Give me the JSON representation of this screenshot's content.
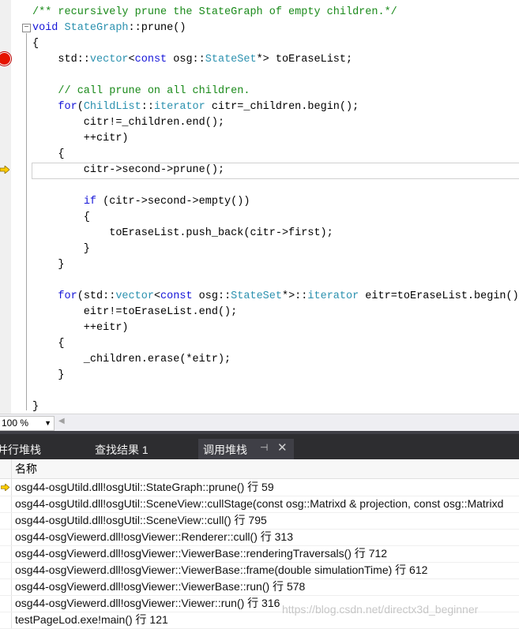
{
  "editor": {
    "lines": [
      [
        [
          "cm",
          "/** recursively prune the StateGraph of empty children.*/"
        ]
      ],
      [
        [
          "kw",
          "void"
        ],
        [
          "tx",
          " "
        ],
        [
          "ty",
          "StateGraph"
        ],
        [
          "tx",
          "::prune()"
        ]
      ],
      [
        [
          "tx",
          "{"
        ]
      ],
      [
        [
          "tx",
          "    std::"
        ],
        [
          "ty",
          "vector"
        ],
        [
          "tx",
          "<"
        ],
        [
          "kw",
          "const"
        ],
        [
          "tx",
          " osg::"
        ],
        [
          "ty",
          "StateSet"
        ],
        [
          "tx",
          "*> toEraseList;"
        ]
      ],
      [],
      [
        [
          "tx",
          "    "
        ],
        [
          "cm",
          "// call prune on all children."
        ]
      ],
      [
        [
          "tx",
          "    "
        ],
        [
          "kw",
          "for"
        ],
        [
          "tx",
          "("
        ],
        [
          "ty",
          "ChildList"
        ],
        [
          "tx",
          "::"
        ],
        [
          "ty",
          "iterator"
        ],
        [
          "tx",
          " citr=_children.begin();"
        ]
      ],
      [
        [
          "tx",
          "        citr!=_children.end();"
        ]
      ],
      [
        [
          "tx",
          "        ++citr)"
        ]
      ],
      [
        [
          "tx",
          "    {"
        ]
      ],
      [
        [
          "tx",
          "        citr->second->prune();"
        ]
      ],
      [],
      [
        [
          "tx",
          "        "
        ],
        [
          "kw",
          "if"
        ],
        [
          "tx",
          " (citr->second->empty())"
        ]
      ],
      [
        [
          "tx",
          "        {"
        ]
      ],
      [
        [
          "tx",
          "            toEraseList.push_back(citr->first);"
        ]
      ],
      [
        [
          "tx",
          "        }"
        ]
      ],
      [
        [
          "tx",
          "    }"
        ]
      ],
      [],
      [
        [
          "tx",
          "    "
        ],
        [
          "kw",
          "for"
        ],
        [
          "tx",
          "(std::"
        ],
        [
          "ty",
          "vector"
        ],
        [
          "tx",
          "<"
        ],
        [
          "kw",
          "const"
        ],
        [
          "tx",
          " osg::"
        ],
        [
          "ty",
          "StateSet"
        ],
        [
          "tx",
          "*>::"
        ],
        [
          "ty",
          "iterator"
        ],
        [
          "tx",
          " eitr=toEraseList.begin();"
        ]
      ],
      [
        [
          "tx",
          "        eitr!=toEraseList.end();"
        ]
      ],
      [
        [
          "tx",
          "        ++eitr)"
        ]
      ],
      [
        [
          "tx",
          "    {"
        ]
      ],
      [
        [
          "tx",
          "        _children.erase(*eitr);"
        ]
      ],
      [
        [
          "tx",
          "    }"
        ]
      ],
      [],
      [
        [
          "tx",
          "}"
        ]
      ]
    ],
    "fold_glyph": "−",
    "breakpoint_color": "#e51400",
    "arrow_color": "#ffcc00"
  },
  "zoombar": {
    "zoom_value": "100 %",
    "dropdown_glyph": "▼",
    "scroll_left_glyph": "◀"
  },
  "tabs": {
    "items": [
      {
        "label": "并行堆栈",
        "name": "tab-parallel-stacks"
      },
      {
        "label": "查找结果 1",
        "name": "tab-find-results"
      },
      {
        "label": "调用堆栈",
        "name": "tab-call-stack"
      }
    ],
    "pin_glyph": "⊣",
    "close_glyph": "✕",
    "bg_color": "#2d2d30"
  },
  "callstack": {
    "column_header": "名称",
    "rows": [
      "osg44-osgUtild.dll!osgUtil::StateGraph::prune() 行 59",
      "osg44-osgUtild.dll!osgUtil::SceneView::cullStage(const osg::Matrixd & projection, const osg::Matrixd",
      "osg44-osgUtild.dll!osgUtil::SceneView::cull() 行 795",
      "osg44-osgViewerd.dll!osgViewer::Renderer::cull() 行 313",
      "osg44-osgViewerd.dll!osgViewer::ViewerBase::renderingTraversals() 行 712",
      "osg44-osgViewerd.dll!osgViewer::ViewerBase::frame(double simulationTime) 行 612",
      "osg44-osgViewerd.dll!osgViewer::ViewerBase::run() 行 578",
      "osg44-osgViewerd.dll!osgViewer::Viewer::run() 行 316",
      "testPageLod.exe!main() 行 121"
    ]
  },
  "watermark": "https://blog.csdn.net/directx3d_beginner"
}
